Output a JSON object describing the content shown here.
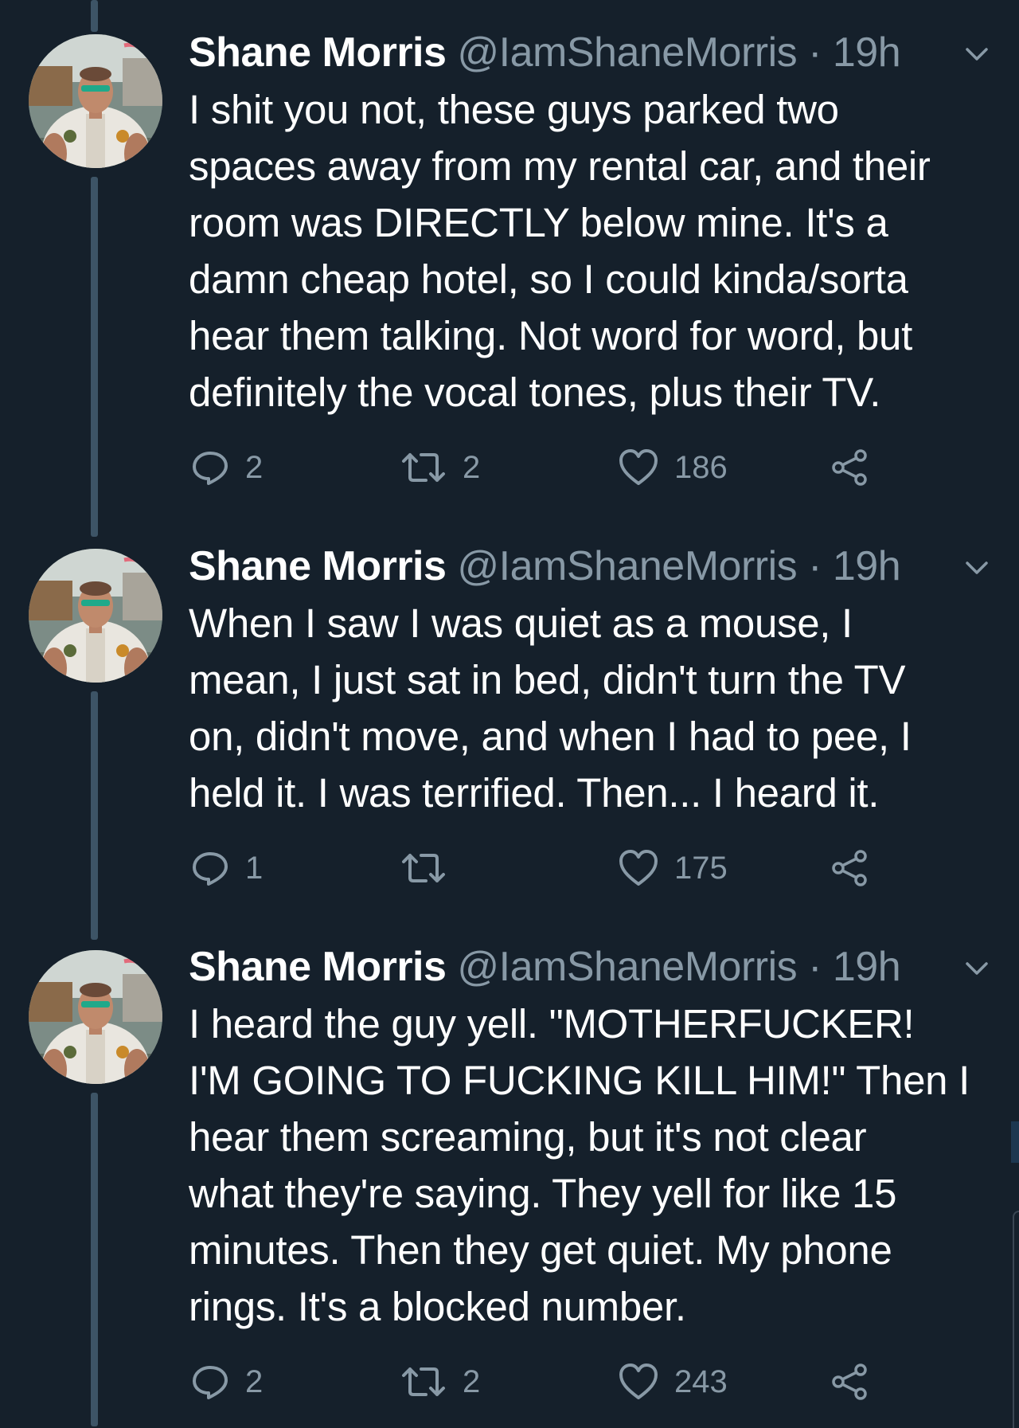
{
  "tweets": [
    {
      "name": "Shane Morris",
      "handle": "@IamShaneMorris",
      "separator": "·",
      "time": "19h",
      "text": "I shit you not, these guys parked two\nspaces away from my rental car, and their\nroom was DIRECTLY below mine. It's a\ndamn cheap hotel, so I could kinda/sorta\nhear them talking. Not word for word, but\ndefinitely the vocal tones, plus their TV.",
      "replies": "2",
      "retweets": "2",
      "likes": "186"
    },
    {
      "name": "Shane Morris",
      "handle": "@IamShaneMorris",
      "separator": "·",
      "time": "19h",
      "text": "When I saw I was quiet as a mouse, I\nmean, I just sat in bed, didn't turn the TV\non, didn't move, and when I had to pee, I\nheld it. I was terrified. Then... I heard it.",
      "replies": "1",
      "retweets": "",
      "likes": "175"
    },
    {
      "name": "Shane Morris",
      "handle": "@IamShaneMorris",
      "separator": "·",
      "time": "19h",
      "text": "I heard the guy yell. \"MOTHERFUCKER!\nI'M GOING TO FUCKING KILL HIM!\" Then I\nhear them screaming, but it's not clear\nwhat they're saying. They yell for like 15\nminutes. Then they get quiet. My phone\nrings. It's a blocked number.",
      "replies": "2",
      "retweets": "2",
      "likes": "243"
    }
  ],
  "icons": {
    "reply": "speech-bubble",
    "retweet": "retweet-arrows",
    "like": "heart-outline",
    "share": "share-nodes",
    "menu": "chevron-down"
  },
  "colors": {
    "background": "#15202b",
    "primary_text": "#ffffff",
    "secondary_text": "#8899a6",
    "thread_line": "#3d5466"
  }
}
